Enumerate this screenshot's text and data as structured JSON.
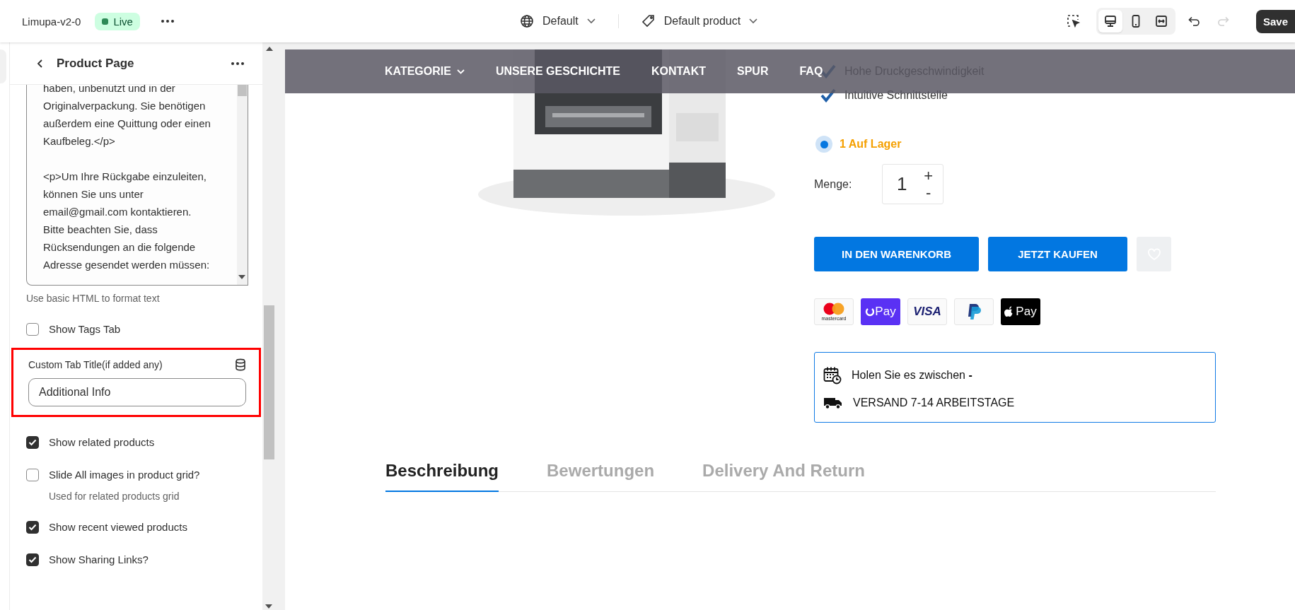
{
  "topbar": {
    "store_name": "Limupa-v2-0",
    "status": {
      "label": "Live",
      "color": "#2e8a57"
    },
    "language": "Default",
    "template": "Default product",
    "view_modes": [
      {
        "kind": "desktop",
        "selected": true
      },
      {
        "kind": "mobile",
        "selected": false
      },
      {
        "kind": "fullwidth",
        "selected": false
      }
    ],
    "history": [
      {
        "kind": "undo",
        "disabled": false
      },
      {
        "kind": "redo",
        "disabled": true
      }
    ],
    "save": "Save"
  },
  "sidebar": {
    "title": "Product Page",
    "editor_paragraphs": [
      [
        "haben, unbenutzt und in der",
        "Originalverpackung. Sie benötigen",
        "außerdem eine Quittung oder einen",
        "Kaufbeleg.</p>"
      ],
      [
        "<p>Um Ihre Rückgabe einzuleiten,",
        "können Sie uns unter",
        "email@gmail.com kontaktieren.",
        "Bitte beachten Sie, dass",
        "Rücksendungen an die folgende",
        "Adresse gesendet werden müssen:"
      ]
    ],
    "editor_hint": "Use basic HTML to format text",
    "settings": [
      {
        "kind": "checkbox",
        "label": "Show Tags Tab",
        "checked": false
      },
      {
        "kind": "text",
        "label": "Custom Tab Title(if added any)",
        "value": "Additional Info",
        "highlighted": true
      },
      {
        "kind": "checkbox",
        "label": "Show related products",
        "checked": true
      },
      {
        "kind": "checkbox",
        "label": "Slide All images in product grid?",
        "hint": "Used for related products grid",
        "checked": false
      },
      {
        "kind": "checkbox",
        "label": "Show recent viewed products",
        "checked": true
      },
      {
        "kind": "checkbox",
        "label": "Show Sharing Links?",
        "checked": true
      }
    ]
  },
  "preview": {
    "nav": [
      {
        "label": "KATEGORIE",
        "has_menu": true
      },
      {
        "label": "UNSERE GESCHICHTE",
        "has_menu": false
      },
      {
        "label": "KONTAKT",
        "has_menu": false
      },
      {
        "label": "SPUR",
        "has_menu": false
      },
      {
        "label": "FAQ",
        "has_menu": false
      }
    ],
    "features": [
      "Hohe Druckgeschwindigkeit",
      "Intuitive Schnittstelle"
    ],
    "stock": "1 Auf Lager",
    "quantity_label": "Menge:",
    "quantity": "1",
    "plus": "+",
    "minus": "-",
    "add_to_cart": "IN DEN WARENKORB",
    "buy_now": "JETZT KAUFEN",
    "payments": [
      {
        "kind": "mastercard",
        "label": "mastercard"
      },
      {
        "kind": "opay",
        "label": "Pay"
      },
      {
        "kind": "visa",
        "label": "VISA"
      },
      {
        "kind": "paypal"
      },
      {
        "kind": "applepay",
        "label": "Pay"
      }
    ],
    "delivery": [
      {
        "kind": "calendar",
        "text": "Holen Sie es zwischen **-**"
      },
      {
        "kind": "truck",
        "text": "VERSAND 7-14 ARBEITSTAGE"
      }
    ],
    "tabs": [
      {
        "label": "Beschreibung",
        "selected": true
      },
      {
        "label": "Bewertungen",
        "selected": false
      },
      {
        "label": "Delivery And Return",
        "selected": false
      }
    ]
  }
}
